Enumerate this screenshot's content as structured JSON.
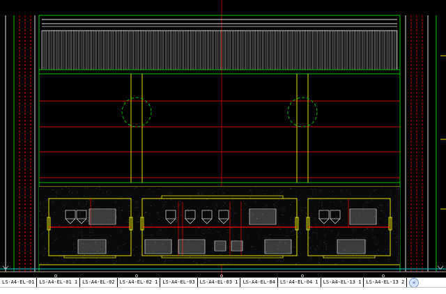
{
  "layout_tabs": [
    "LS-A4-EL-01",
    "LS-A4-EL-01 1",
    "LS-A4-EL-02",
    "LS-A4-EL-02 1",
    "LS-A4-EL-03",
    "LS-A4-EL-03 1",
    "LS-A4-EL-04",
    "LS-A4-EL-04 1",
    "LS-A4-EL-13 1",
    "LS-A4-EL-13 2"
  ],
  "nav_icon": "scroll-tabs-icon",
  "colors": {
    "background": "#000000",
    "green": "#00c000",
    "red": "#d00000",
    "yellow": "#e0e000",
    "white": "#e0e0e0",
    "cyan": "#00d0d0"
  }
}
